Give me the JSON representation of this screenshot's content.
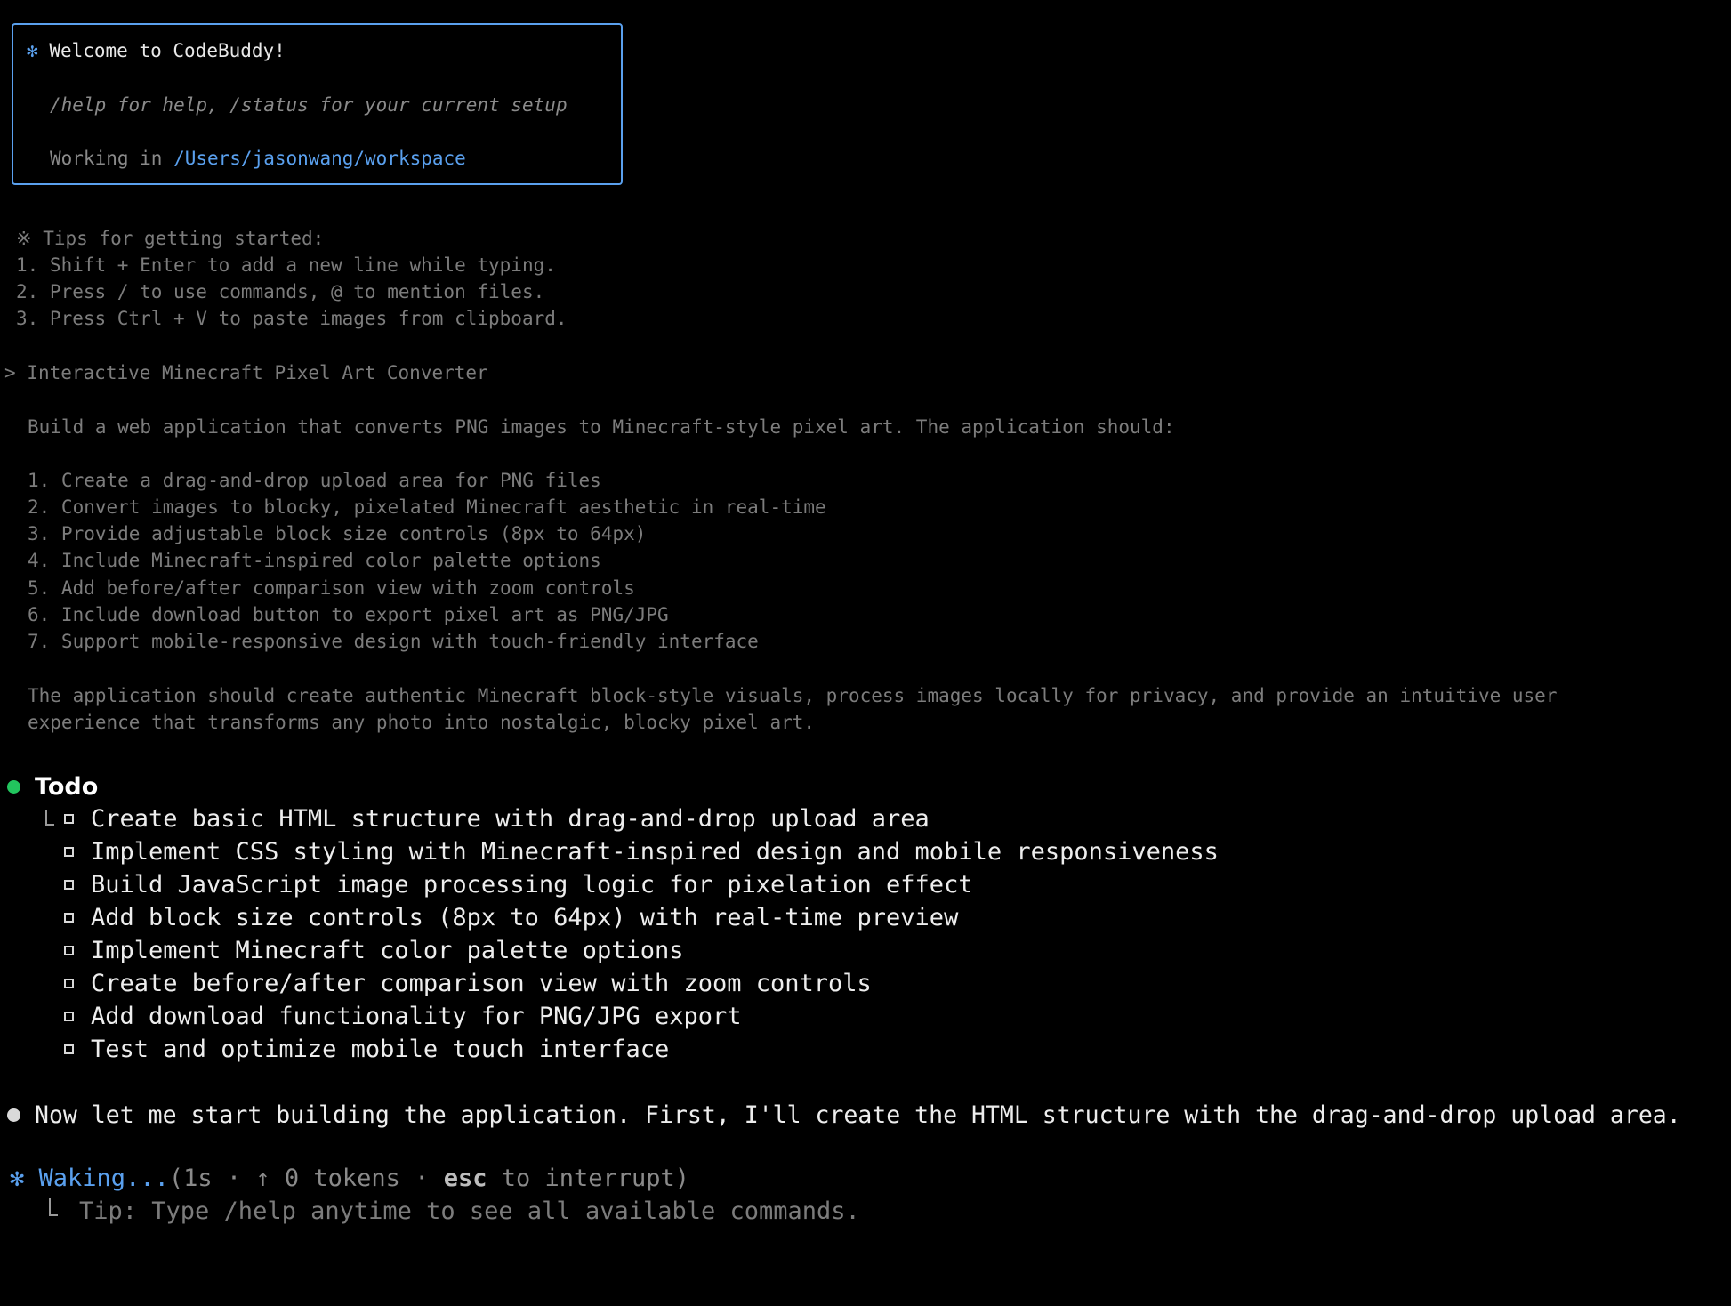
{
  "welcome": {
    "star": "✻",
    "title": "Welcome to CodeBuddy!",
    "help": "/help for help, /status for your current setup",
    "working_prefix": "Working in ",
    "working_path": "/Users/jasonwang/workspace"
  },
  "tips": {
    "header": "※ Tips for getting started:",
    "items": [
      "1. Shift + Enter to add a new line while typing.",
      "2. Press / to use commands, @ to mention files.",
      "3. Press Ctrl + V to paste images from clipboard."
    ]
  },
  "prompt": {
    "marker": ">",
    "title": "Interactive Minecraft Pixel Art Converter",
    "intro": "Build a web application that converts PNG images to Minecraft-style pixel art. The application should:",
    "items": [
      "1. Create a drag-and-drop upload area for PNG files",
      "2. Convert images to blocky, pixelated Minecraft aesthetic in real-time",
      "3. Provide adjustable block size controls (8px to 64px)",
      "4. Include Minecraft-inspired color palette options",
      "5. Add before/after comparison view with zoom controls",
      "6. Include download button to export pixel art as PNG/JPG",
      "7. Support mobile-responsive design with touch-friendly interface"
    ],
    "outro_line1": "The application should create authentic Minecraft block-style visuals, process images locally for privacy, and provide an intuitive user",
    "outro_line2": "experience that transforms any photo into nostalgic, blocky pixel art."
  },
  "todo": {
    "title": "Todo",
    "items": [
      "Create basic HTML structure with drag-and-drop upload area",
      "Implement CSS styling with Minecraft-inspired design and mobile responsiveness",
      "Build JavaScript image processing logic for pixelation effect",
      "Add block size controls (8px to 64px) with real-time preview",
      "Implement Minecraft color palette options",
      "Create before/after comparison view with zoom controls",
      "Add download functionality for PNG/JPG export",
      "Test and optimize mobile touch interface"
    ]
  },
  "message": "Now let me start building the application. First, I'll create the HTML structure with the drag-and-drop upload area.",
  "status": {
    "star": "✻",
    "word": "Waking...",
    "meta_open": "(1s · ↑ 0 tokens · ",
    "esc": "esc",
    "meta_close": " to interrupt)",
    "tip": "Tip: Type /help anytime to see all available commands."
  },
  "colors": {
    "accent_blue": "#5aa0ee",
    "todo_dot": "#22c55e",
    "background": "#000000"
  }
}
